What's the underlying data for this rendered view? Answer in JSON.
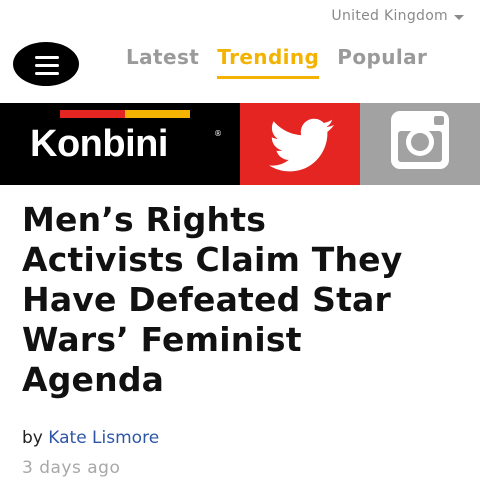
{
  "header": {
    "region_label": "United Kingdom",
    "tabs": [
      "Latest",
      "Trending",
      "Popular"
    ],
    "active_tab": "Trending"
  },
  "brand": {
    "logo_text": "Konbini",
    "logo_mark": "®",
    "social": [
      "twitter-icon",
      "instagram-icon"
    ]
  },
  "article": {
    "headline_lines": [
      "Men’s Rights",
      "Activists Claim They",
      "Have Defeated Star",
      "Wars’ Feminist",
      "Agenda"
    ],
    "by_prefix": "by",
    "author": "Kate Lismore",
    "timestamp": "3 days ago"
  },
  "colors": {
    "accent": "#f3b300",
    "author_link": "#2e56a6",
    "twitter_red": "#e52521",
    "instagram_gray": "#a2a2a2",
    "stripe_red": "#e52521",
    "stripe_yellow": "#f3b300"
  }
}
